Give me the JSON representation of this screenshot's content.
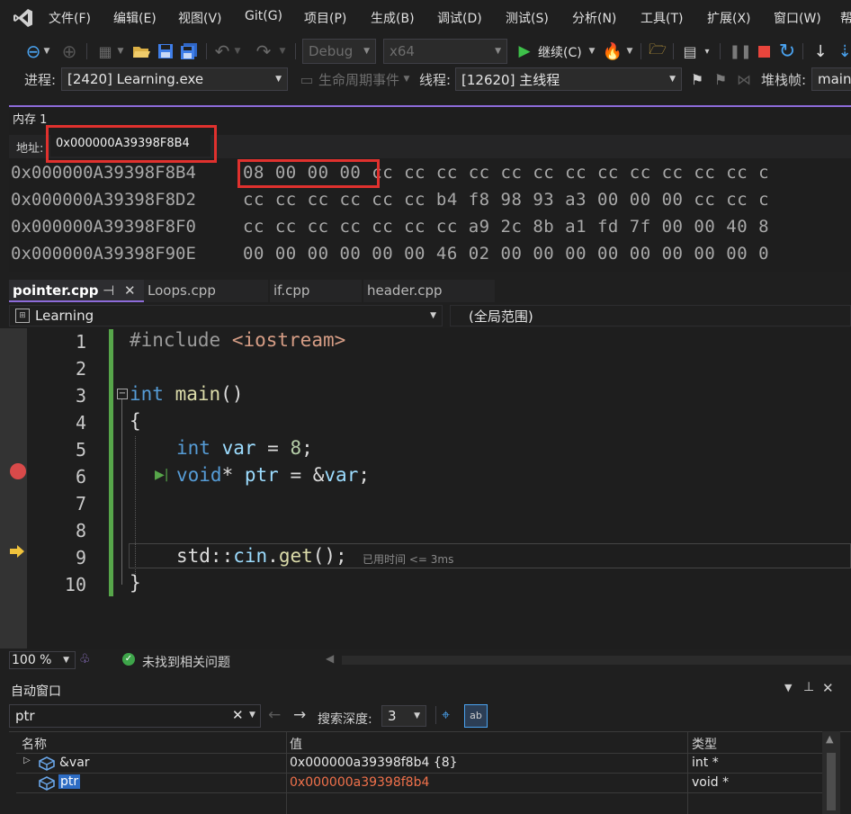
{
  "menubar": {
    "items": [
      "文件(F)",
      "编辑(E)",
      "视图(V)",
      "Git(G)",
      "项目(P)",
      "生成(B)",
      "调试(D)",
      "测试(S)",
      "分析(N)",
      "工具(T)",
      "扩展(X)",
      "窗口(W)",
      "帮"
    ]
  },
  "toolbar": {
    "config": "Debug",
    "platform": "x64",
    "continue_label": "继续(C)"
  },
  "debugbar": {
    "process_label": "进程:",
    "process_value": "[2420] Learning.exe",
    "lifecycle_label": "生命周期事件",
    "thread_label": "线程:",
    "thread_value": "[12620] 主线程",
    "stackframe_label": "堆栈帧:",
    "stackframe_value": "main"
  },
  "memory": {
    "title": "内存 1",
    "address_label": "地址:",
    "address_value": "0x000000A39398F8B4",
    "rows": [
      {
        "addr": "0x000000A39398F8B4",
        "bytes": "08 00 00 00 cc cc cc cc cc cc cc cc cc cc cc cc c"
      },
      {
        "addr": "0x000000A39398F8D2",
        "bytes": "cc cc cc cc cc cc b4 f8 98 93 a3 00 00 00 cc cc c"
      },
      {
        "addr": "0x000000A39398F8F0",
        "bytes": "cc cc cc cc cc cc cc a9 2c 8b a1 fd 7f 00 00 40 8"
      },
      {
        "addr": "0x000000A39398F90E",
        "bytes": "00 00 00 00 00 00 46 02 00 00 00 00 00 00 00 00 0"
      }
    ]
  },
  "tabs": [
    {
      "label": "pointer.cpp",
      "pin": "⊣",
      "close": "✕"
    },
    {
      "label": "Loops.cpp"
    },
    {
      "label": "if.cpp"
    },
    {
      "label": "header.cpp"
    }
  ],
  "navbar": {
    "project": "Learning",
    "scope": "(全局范围)"
  },
  "editor": {
    "line_numbers": [
      "1",
      "2",
      "3",
      "4",
      "5",
      "6",
      "7",
      "8",
      "9",
      "10"
    ],
    "include_kw": "#include",
    "include_file": "<iostream>",
    "int_kw": "int",
    "main_fn": "main",
    "main_parens": "()",
    "open_brace": "{",
    "close_brace": "}",
    "var_decl_type": "int",
    "var_decl_name": "var",
    "var_decl_rest": " = ",
    "var_decl_value": "8",
    "semicolon": ";",
    "ptr_type": "void",
    "ptr_star": "*",
    "ptr_name": "ptr",
    "ptr_assign": " = &",
    "ptr_target": "var",
    "cin_ns": "std::",
    "cin_obj": "cin",
    "cin_dot": ".",
    "cin_fn": "get",
    "cin_end": "();",
    "elapsed": "已用时间 <= 3ms"
  },
  "edstatus": {
    "zoom": "100 %",
    "issues": "未找到相关问题"
  },
  "autos": {
    "title": "自动窗口",
    "search_value": "ptr",
    "depth_label": "搜索深度:",
    "depth_value": "3",
    "columns": [
      "名称",
      "值",
      "类型"
    ],
    "rows": [
      {
        "name": "&var",
        "value": "0x000000a39398f8b4 {8}",
        "type": "int *"
      },
      {
        "name": "ptr",
        "value": "0x000000a39398f8b4",
        "type": "void *"
      }
    ]
  },
  "colors": {
    "accent": "#8d6bd9",
    "highlight_red": "#e0312e",
    "changed_value": "#f0714b",
    "keyword": "#569cd6"
  }
}
